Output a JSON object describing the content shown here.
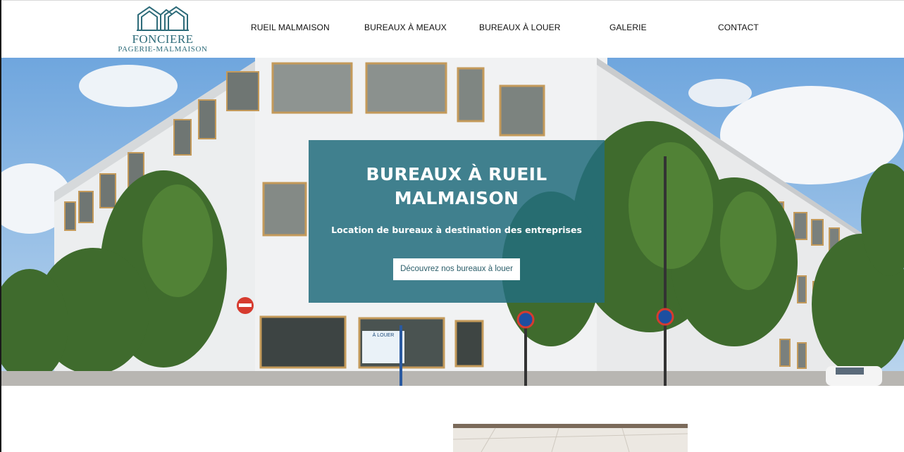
{
  "logo": {
    "name_line1": "FONCIERE",
    "name_line2": "PAGERIE-MALMAISON",
    "brand_color": "#2d6b79",
    "icon": "building-roofs-icon"
  },
  "nav": {
    "items": [
      {
        "label": "RUEIL MALMAISON"
      },
      {
        "label": "BUREAUX À MEAUX"
      },
      {
        "label": "BUREAUX À LOUER"
      },
      {
        "label": "GALERIE"
      },
      {
        "label": "CONTACT"
      }
    ]
  },
  "hero": {
    "title_line1": "BUREAUX À RUEIL",
    "title_line2": "MALMAISON",
    "subtitle": "Location de bureaux à destination des entreprises",
    "cta_label": "Découvrez nos bureaux à louer",
    "overlay_color": "#236e7d",
    "sign_label": "À LOUER"
  }
}
